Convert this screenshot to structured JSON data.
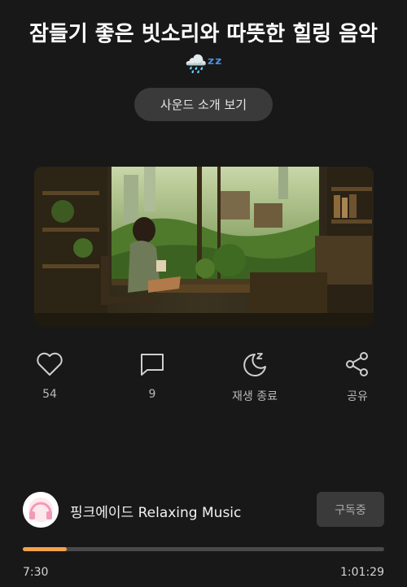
{
  "title": {
    "text": "잠들기 좋은 빗소리와 따뜻한 힐링 음악",
    "emoji": "🌧️ᶻᶻ"
  },
  "intro_button": {
    "label": "사운드 소개 보기"
  },
  "actions": [
    {
      "icon": "heart-icon",
      "label": "54"
    },
    {
      "icon": "comment-icon",
      "label": "9"
    },
    {
      "icon": "sleep-timer-icon",
      "label": "재생 종료"
    },
    {
      "icon": "share-icon",
      "label": "공유"
    }
  ],
  "channel": {
    "name": "핑크에이드 Relaxing Music",
    "subscribe_label": "구독중"
  },
  "player": {
    "current_time": "7:30",
    "duration": "1:01:29",
    "progress": 0.122
  },
  "colors": {
    "background": "#181818",
    "accent": "#f5a04a",
    "button": "#3a3a3a"
  }
}
